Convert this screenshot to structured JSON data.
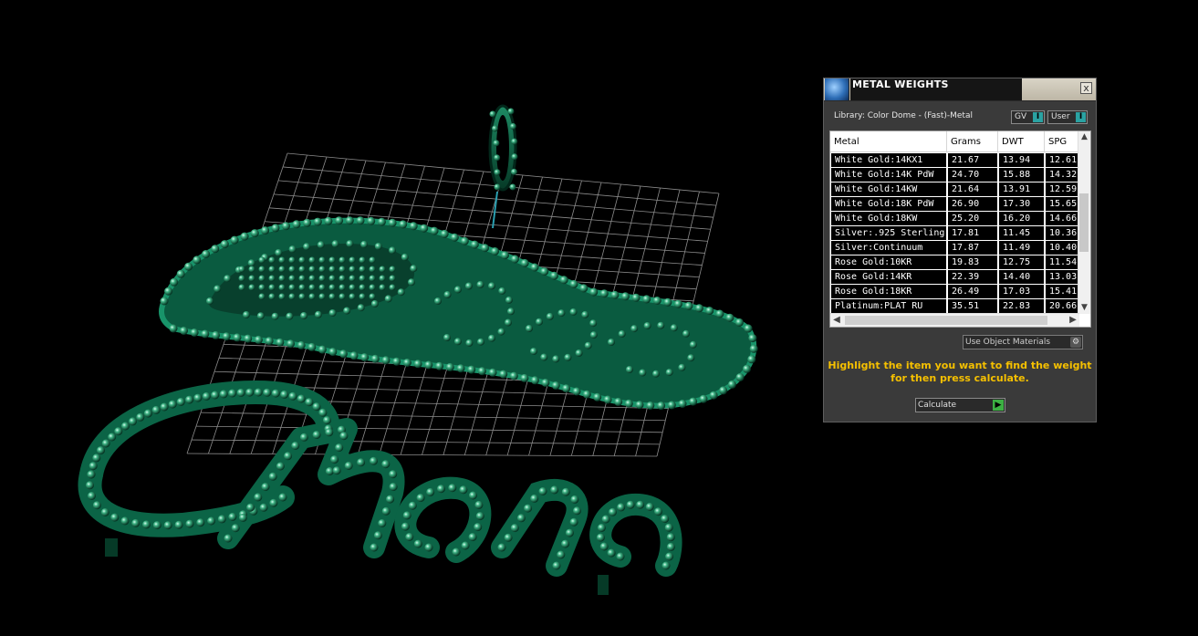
{
  "colors": {
    "background": "#000000",
    "model_green": "#0d6b4c",
    "model_highlight": "#6fd3a6",
    "grid": "#8c8c8c",
    "instruction_text": "#f5c000",
    "toggle_accent": "#2aa2a2"
  },
  "viewport": {
    "model_text": "Chana"
  },
  "panel": {
    "title": "METAL WEIGHTS",
    "close_label": "x",
    "library_label": "Library: Color Dome - (Fast)-Metal",
    "gv_label": "GV",
    "user_label": "User",
    "toggle_glyph": "I",
    "columns": [
      "Metal",
      "Grams",
      "DWT",
      "SPG"
    ],
    "rows": [
      [
        "White Gold:14KX1",
        "21.67",
        "13.94",
        "12.61"
      ],
      [
        "White Gold:14K PdW",
        "24.70",
        "15.88",
        "14.32"
      ],
      [
        "White Gold:14KW",
        "21.64",
        "13.91",
        "12.59"
      ],
      [
        "White Gold:18K PdW",
        "26.90",
        "17.30",
        "15.65"
      ],
      [
        "White Gold:18KW",
        "25.20",
        "16.20",
        "14.66"
      ],
      [
        "Silver:.925 Sterling",
        "17.81",
        "11.45",
        "10.36"
      ],
      [
        "Silver:Continuum",
        "17.87",
        "11.49",
        "10.40"
      ],
      [
        "Rose Gold:10KR",
        "19.83",
        "12.75",
        "11.54"
      ],
      [
        "Rose Gold:14KR",
        "22.39",
        "14.40",
        "13.03"
      ],
      [
        "Rose Gold:18KR",
        "26.49",
        "17.03",
        "15.41"
      ],
      [
        "Platinum:PLAT RU",
        "35.51",
        "22.83",
        "20.66"
      ]
    ],
    "use_object_materials": "Use Object Materials",
    "instruction": "Highlight the item you want to find the weight for then press calculate.",
    "calculate_label": "Calculate"
  }
}
